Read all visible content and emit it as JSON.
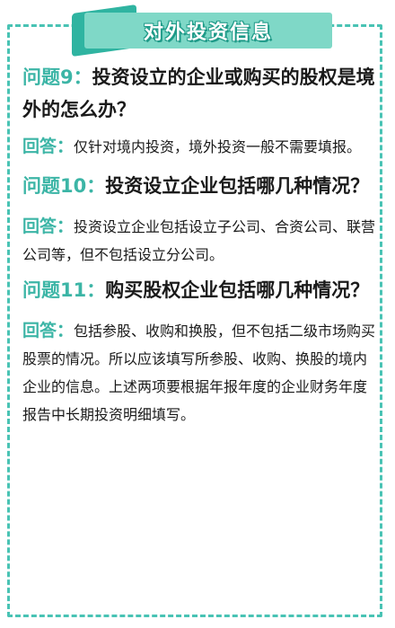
{
  "header": {
    "title": "对外投资信息"
  },
  "items": [
    {
      "q_label": "问题9：",
      "q_text": "投资设立的企业或购买的股权是境外的怎么办？",
      "a_label": "回答：",
      "a_text": "仅针对境内投资，境外投资一般不需要填报。"
    },
    {
      "q_label": "问题10：",
      "q_text": "投资设立企业包括哪几种情况？",
      "a_label": "回答：",
      "a_text": "投资设立企业包括设立子公司、合资公司、联营公司等，但不包括设立分公司。"
    },
    {
      "q_label": "问题11：",
      "q_text": "购买股权企业包括哪几种情况？",
      "a_label": "回答：",
      "a_text": "包括参股、收购和换股，但不包括二级市场购买股票的情况。所以应该填写所参股、收购、换股的境内企业的信息。上述两项要根据年报年度的企业财务年度报告中长期投资明细填写。"
    }
  ]
}
